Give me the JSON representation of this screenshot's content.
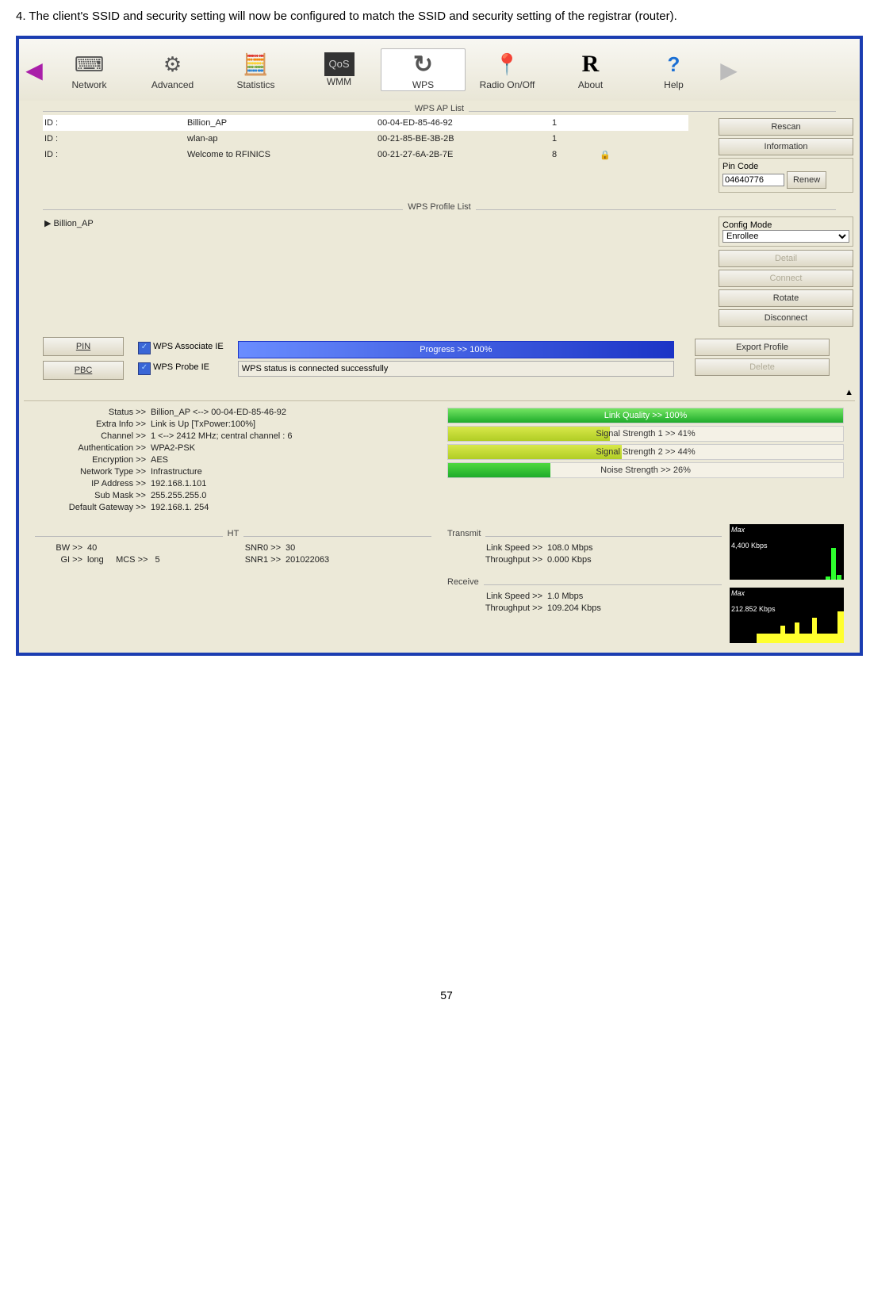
{
  "doc_text": "4. The client's SSID and security setting will now be configured to match the SSID and security setting of the registrar (router).",
  "toolbar": {
    "items": [
      {
        "label": "Network",
        "icon": "⌨"
      },
      {
        "label": "Advanced",
        "icon": "⚙"
      },
      {
        "label": "Statistics",
        "icon": "🧮"
      },
      {
        "label": "WMM",
        "icon": "QoS"
      },
      {
        "label": "WPS",
        "icon": "↻"
      },
      {
        "label": "Radio On/Off",
        "icon": "📍"
      },
      {
        "label": "About",
        "icon": "R"
      },
      {
        "label": "Help",
        "icon": "?"
      }
    ]
  },
  "ap_list_title": "WPS AP List",
  "ap_rows": [
    {
      "id": "ID :",
      "ssid": "Billion_AP",
      "bssid": "00-04-ED-85-46-92",
      "ch": "1"
    },
    {
      "id": "ID :",
      "ssid": "wlan-ap",
      "bssid": "00-21-85-BE-3B-2B",
      "ch": "1"
    },
    {
      "id": "ID :",
      "ssid": "Welcome to RFINICS",
      "bssid": "00-21-27-6A-2B-7E",
      "ch": "8"
    }
  ],
  "side": {
    "rescan": "Rescan",
    "information": "Information",
    "pin_code_label": "Pin Code",
    "pin_code_val": "04640776",
    "renew": "Renew",
    "config_mode_label": "Config Mode",
    "config_mode_val": "Enrollee",
    "detail": "Detail",
    "connect": "Connect",
    "rotate": "Rotate",
    "disconnect": "Disconnect",
    "export": "Export Profile",
    "delete": "Delete"
  },
  "profile_list_title": "WPS Profile List",
  "profile_item": "Billion_AP",
  "wps": {
    "pin": "PIN",
    "pbc": "PBC",
    "assoc": "WPS Associate IE",
    "probe": "WPS Probe IE",
    "progress": "Progress >> 100%",
    "status": "WPS status is connected successfully"
  },
  "status": {
    "status_k": "Status >>",
    "status_v": "Billion_AP <--> 00-04-ED-85-46-92",
    "extra_k": "Extra Info >>",
    "extra_v": "Link is Up [TxPower:100%]",
    "channel_k": "Channel >>",
    "channel_v": "1 <--> 2412 MHz; central channel : 6",
    "auth_k": "Authentication >>",
    "auth_v": "WPA2-PSK",
    "enc_k": "Encryption >>",
    "enc_v": "AES",
    "net_k": "Network Type >>",
    "net_v": "Infrastructure",
    "ip_k": "IP Address >>",
    "ip_v": "192.168.1.101",
    "mask_k": "Sub Mask >>",
    "mask_v": "255.255.255.0",
    "gw_k": "Default Gateway >>",
    "gw_v": "192.168.1. 254"
  },
  "bars": {
    "lq": "Link Quality >> 100%",
    "s1": "Signal Strength 1 >> 41%",
    "s2": "Signal Strength 2 >> 44%",
    "ns": "Noise Strength >> 26%"
  },
  "ht": {
    "title": "HT",
    "bw_k": "BW >>",
    "bw_v": "40",
    "gi_k": "GI >>",
    "gi_v": "long",
    "mcs_k": "MCS >>",
    "mcs_v": "5",
    "snr0_k": "SNR0 >>",
    "snr0_v": "30",
    "snr1_k": "SNR1 >>",
    "snr1_v": "201022063"
  },
  "tx": {
    "title": "Transmit",
    "ls_k": "Link Speed >>",
    "ls_v": "108.0 Mbps",
    "tp_k": "Throughput >>",
    "tp_v": "0.000 Kbps",
    "max": "Max",
    "scale": "4,400 Kbps"
  },
  "rx": {
    "title": "Receive",
    "ls_k": "Link Speed >>",
    "ls_v": "1.0 Mbps",
    "tp_k": "Throughput >>",
    "tp_v": "109.204 Kbps",
    "max": "Max",
    "scale": "212.852 Kbps"
  },
  "page_number": "57"
}
